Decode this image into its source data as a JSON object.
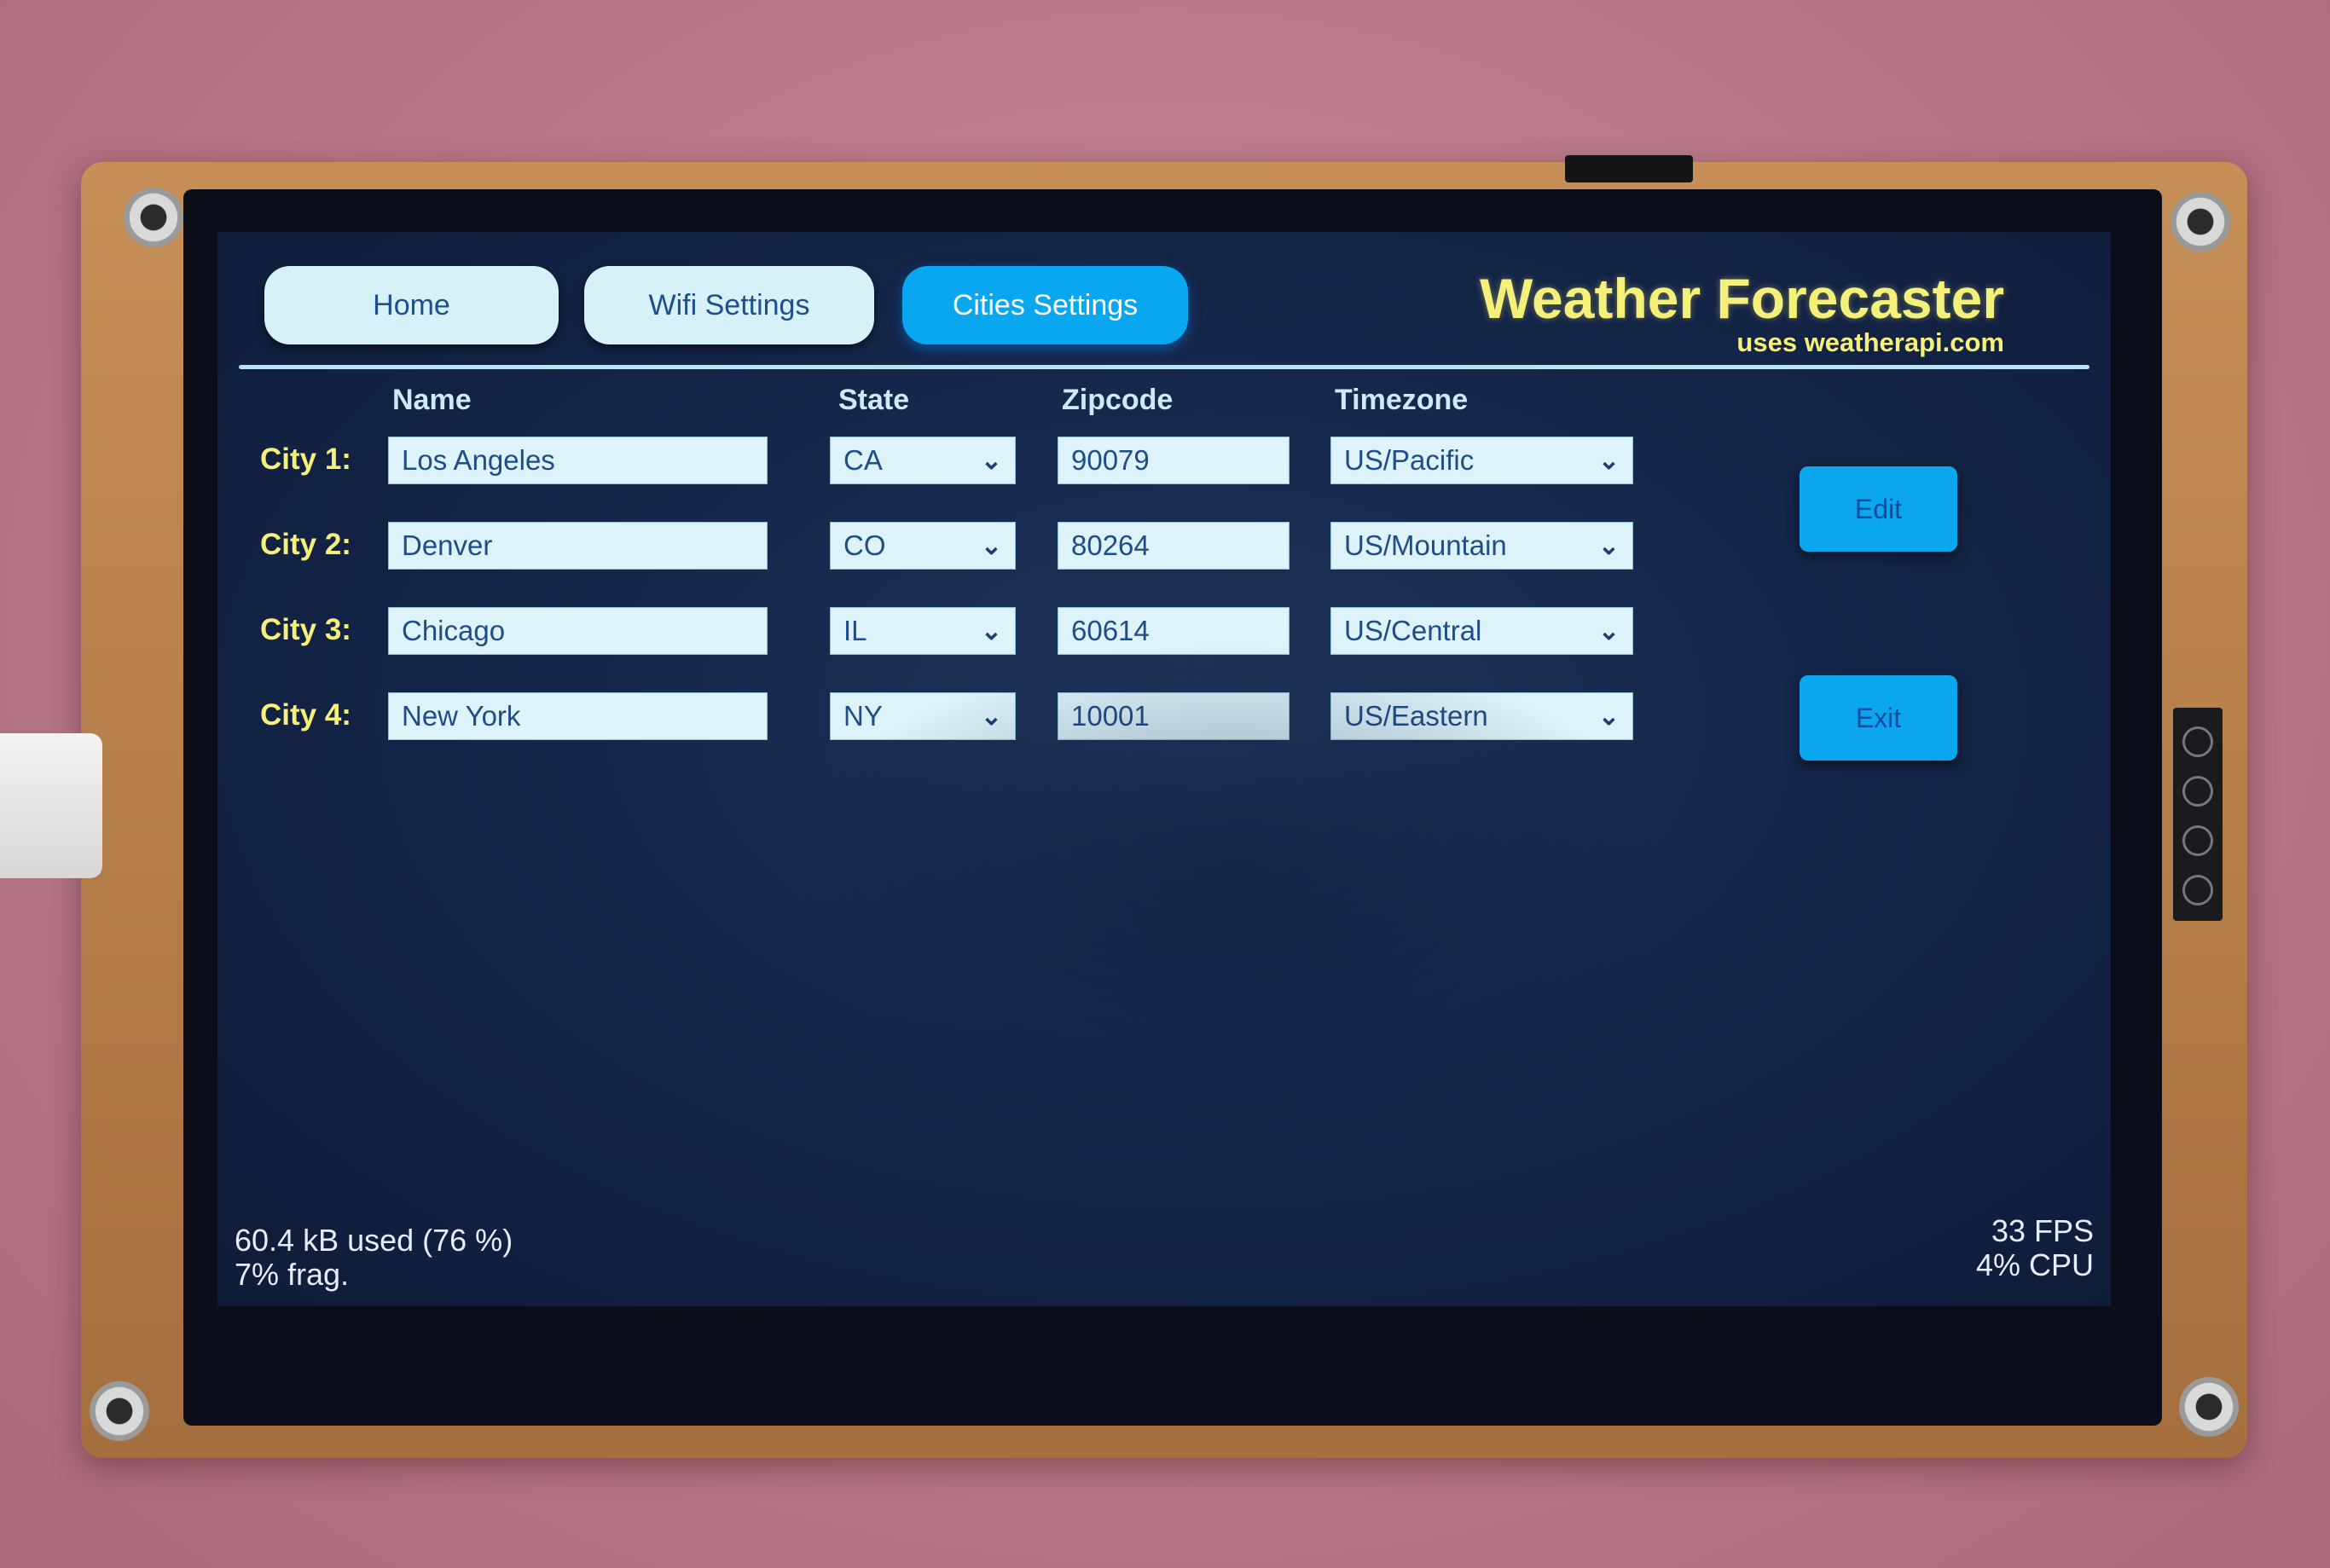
{
  "tabs": {
    "home": "Home",
    "wifi": "Wifi Settings",
    "cities": "Cities Settings"
  },
  "header": {
    "title": "Weather Forecaster",
    "subtitle": "uses weatherapi.com"
  },
  "columns": {
    "name": "Name",
    "state": "State",
    "zipcode": "Zipcode",
    "timezone": "Timezone"
  },
  "cities": [
    {
      "label": "City 1:",
      "name": "Los Angeles",
      "state": "CA",
      "zipcode": "90079",
      "timezone": "US/Pacific"
    },
    {
      "label": "City 2:",
      "name": "Denver",
      "state": "CO",
      "zipcode": "80264",
      "timezone": "US/Mountain"
    },
    {
      "label": "City 3:",
      "name": "Chicago",
      "state": "IL",
      "zipcode": "60614",
      "timezone": "US/Central"
    },
    {
      "label": "City 4:",
      "name": "New York",
      "state": "NY",
      "zipcode": "10001",
      "timezone": "US/Eastern"
    }
  ],
  "buttons": {
    "edit": "Edit",
    "exit": "Exit"
  },
  "stats": {
    "memory_used": "60.4 kB used (76 %)",
    "fragmentation": "7% frag.",
    "fps": "33 FPS",
    "cpu": "4% CPU"
  },
  "icons": {
    "dropdown": "chevron-down-icon"
  },
  "colors": {
    "active_tab": "#08a7ef",
    "title": "#f4f07a",
    "field_bg": "#def2fa",
    "screen_bg": "#15264a"
  }
}
